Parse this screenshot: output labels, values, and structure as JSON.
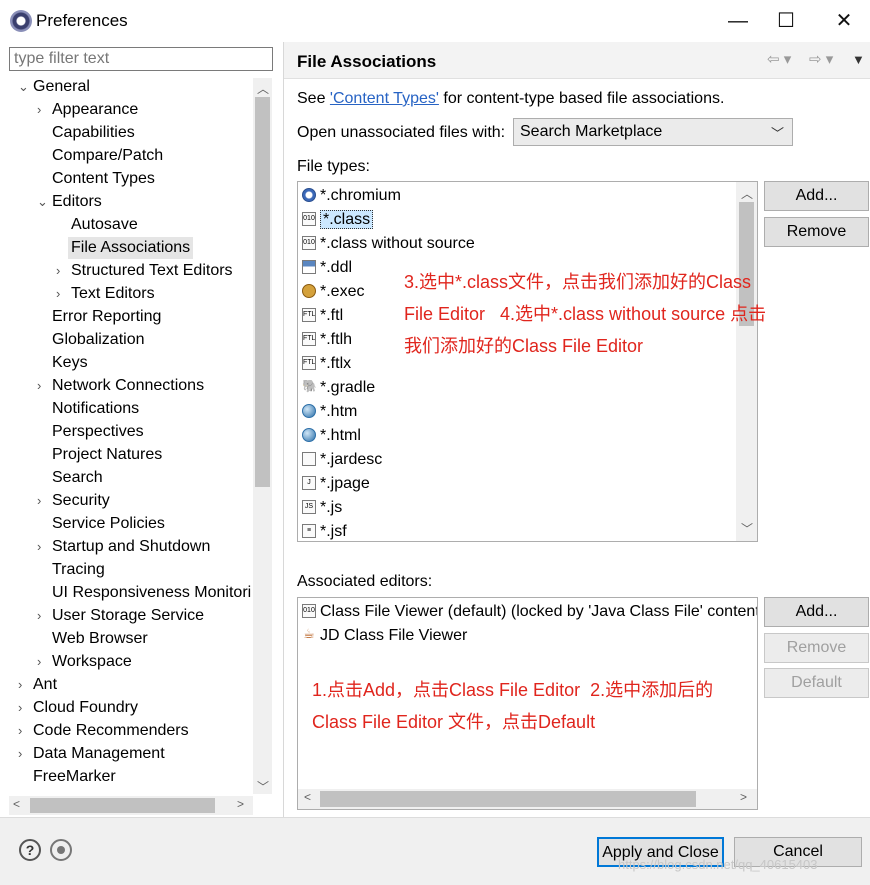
{
  "window": {
    "title": "Preferences",
    "controls": {
      "minimize": "—",
      "maximize": "☐",
      "close": "✕"
    }
  },
  "sidebar": {
    "filter_placeholder": "type filter text",
    "tree": [
      {
        "label": "General",
        "expanded": true,
        "level": 0
      },
      {
        "label": "Appearance",
        "level": 1,
        "expandable": true
      },
      {
        "label": "Capabilities",
        "level": 1
      },
      {
        "label": "Compare/Patch",
        "level": 1
      },
      {
        "label": "Content Types",
        "level": 1
      },
      {
        "label": "Editors",
        "expanded": true,
        "level": 1
      },
      {
        "label": "Autosave",
        "level": 2
      },
      {
        "label": "File Associations",
        "level": 2,
        "selected": true
      },
      {
        "label": "Structured Text Editors",
        "level": 2,
        "expandable": true
      },
      {
        "label": "Text Editors",
        "level": 2,
        "expandable": true
      },
      {
        "label": "Error Reporting",
        "level": 1
      },
      {
        "label": "Globalization",
        "level": 1
      },
      {
        "label": "Keys",
        "level": 1
      },
      {
        "label": "Network Connections",
        "level": 1,
        "expandable": true
      },
      {
        "label": "Notifications",
        "level": 1
      },
      {
        "label": "Perspectives",
        "level": 1
      },
      {
        "label": "Project Natures",
        "level": 1
      },
      {
        "label": "Search",
        "level": 1
      },
      {
        "label": "Security",
        "level": 1,
        "expandable": true
      },
      {
        "label": "Service Policies",
        "level": 1
      },
      {
        "label": "Startup and Shutdown",
        "level": 1,
        "expandable": true
      },
      {
        "label": "Tracing",
        "level": 1
      },
      {
        "label": "UI Responsiveness Monitori",
        "level": 1
      },
      {
        "label": "User Storage Service",
        "level": 1,
        "expandable": true
      },
      {
        "label": "Web Browser",
        "level": 1
      },
      {
        "label": "Workspace",
        "level": 1,
        "expandable": true
      },
      {
        "label": "Ant",
        "level": 0,
        "expandable": true
      },
      {
        "label": "Cloud Foundry",
        "level": 0,
        "expandable": true
      },
      {
        "label": "Code Recommenders",
        "level": 0,
        "expandable": true
      },
      {
        "label": "Data Management",
        "level": 0,
        "expandable": true
      },
      {
        "label": "FreeMarker",
        "level": 0
      }
    ]
  },
  "page": {
    "title": "File Associations",
    "see_prefix": "See ",
    "see_link": "'Content Types'",
    "see_suffix": " for content-type based file associations.",
    "open_unassociated_label": "Open unassociated files with:",
    "open_unassociated_value": "Search Marketplace",
    "file_types_label": "File types:",
    "file_types": [
      {
        "name": "*.chromium",
        "icon": "chromium-icon"
      },
      {
        "name": "*.class",
        "icon": "class-file-icon",
        "selected": true
      },
      {
        "name": "*.class without source",
        "icon": "class-file-icon"
      },
      {
        "name": "*.ddl",
        "icon": "ddl-icon"
      },
      {
        "name": "*.exec",
        "icon": "gear-icon"
      },
      {
        "name": "*.ftl",
        "icon": "ftl-icon"
      },
      {
        "name": "*.ftlh",
        "icon": "ftl-icon"
      },
      {
        "name": "*.ftlx",
        "icon": "ftl-icon"
      },
      {
        "name": "*.gradle",
        "icon": "elephant-icon"
      },
      {
        "name": "*.htm",
        "icon": "globe-icon"
      },
      {
        "name": "*.html",
        "icon": "globe-icon"
      },
      {
        "name": "*.jardesc",
        "icon": "jar-icon"
      },
      {
        "name": "*.jpage",
        "icon": "jpage-icon"
      },
      {
        "name": "*.js",
        "icon": "js-file-icon"
      },
      {
        "name": "*.jsf",
        "icon": "text-file-icon"
      }
    ],
    "file_types_buttons": {
      "add": "Add...",
      "remove": "Remove"
    },
    "annotation_top": "3.选中*.class文件，点击我们添加好的Class\nFile Editor   4.选中*.class without source 点击\n我们添加好的Class File Editor",
    "associated_editors_label": "Associated editors:",
    "associated_editors": [
      {
        "name": "Class File Viewer (default) (locked by 'Java Class File' content",
        "icon": "class-viewer-icon"
      },
      {
        "name": "JD Class File Viewer",
        "icon": "coffee-cup-icon"
      }
    ],
    "editors_buttons": {
      "add": "Add...",
      "remove": "Remove",
      "default": "Default"
    },
    "annotation_bottom": "1.点击Add，点击Class File Editor  2.选中添加后的\nClass File Editor 文件，点击Default"
  },
  "footer": {
    "apply_close": "Apply and Close",
    "cancel": "Cancel",
    "help_glyph": "?",
    "watermark": "https://blog.csdn.net/qq_40615403"
  }
}
